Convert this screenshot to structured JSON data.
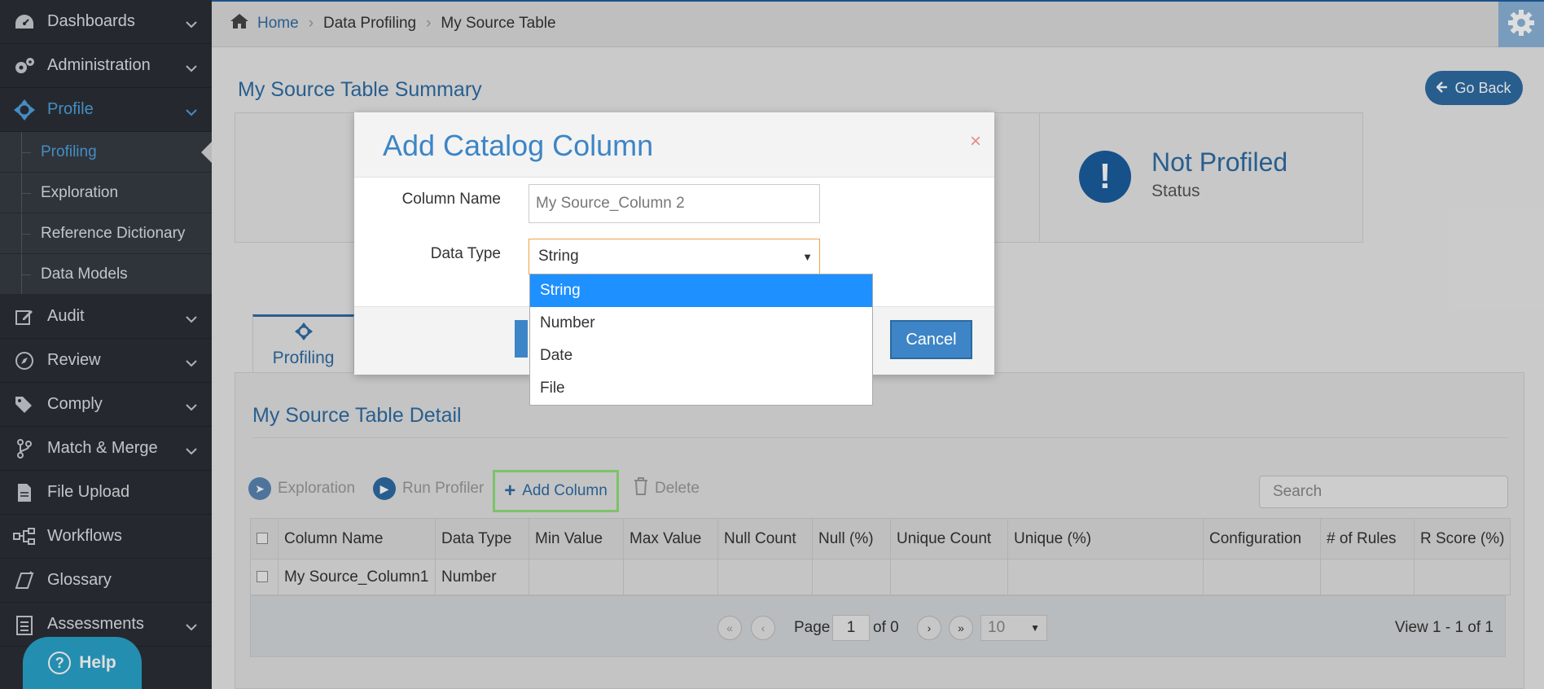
{
  "sidebar": {
    "items": [
      {
        "label": "Dashboards",
        "icon": "dashboard-icon"
      },
      {
        "label": "Administration",
        "icon": "gears-icon"
      },
      {
        "label": "Profile",
        "icon": "crosshair-icon"
      },
      {
        "label": "Audit",
        "icon": "edit-icon"
      },
      {
        "label": "Review",
        "icon": "compass-icon"
      },
      {
        "label": "Comply",
        "icon": "tags-icon"
      },
      {
        "label": "Match & Merge",
        "icon": "branch-icon"
      },
      {
        "label": "File Upload",
        "icon": "file-icon"
      },
      {
        "label": "Workflows",
        "icon": "workflow-icon"
      },
      {
        "label": "Glossary",
        "icon": "book-icon"
      },
      {
        "label": "Assessments",
        "icon": "clipboard-icon"
      }
    ],
    "profile_sub": [
      "Profiling",
      "Exploration",
      "Reference Dictionary",
      "Data Models"
    ],
    "help_label": "Help"
  },
  "breadcrumb": {
    "home": "Home",
    "item1": "Data Profiling",
    "item2": "My Source Table"
  },
  "page": {
    "title": "My Source Table Summary",
    "go_back": "Go Back",
    "status_title": "Not Profiled",
    "status_label": "Status",
    "tab_label": "Profiling",
    "detail_title": "My Source Table Detail"
  },
  "toolbar": {
    "exploration": "Exploration",
    "run_profiler": "Run Profiler",
    "add_column": "Add Column",
    "delete": "Delete",
    "search_placeholder": "Search"
  },
  "table": {
    "columns": [
      "Column Name",
      "Data Type",
      "Min Value",
      "Max Value",
      "Null Count",
      "Null (%)",
      "Unique Count",
      "Unique (%)",
      "Configuration",
      "# of Rules",
      "R Score (%)"
    ],
    "rows": [
      {
        "column_name": "My Source_Column1",
        "data_type": "Number"
      }
    ]
  },
  "pager": {
    "page_label": "Page",
    "page_value": "1",
    "of_label": "of 0",
    "page_size": "10",
    "view_text": "View 1 - 1 of 1"
  },
  "modal": {
    "title": "Add Catalog Column",
    "close": "×",
    "column_name_label": "Column Name",
    "column_name_value": "My Source_Column 2",
    "data_type_label": "Data Type",
    "data_type_value": "String",
    "cancel": "Cancel",
    "options": [
      "String",
      "Number",
      "Date",
      "File"
    ]
  },
  "colors": {
    "accent": "#3d85c6",
    "sidebar_bg": "#2b3036",
    "highlight": "#8fe07a",
    "selected_option": "#1e90ff"
  }
}
